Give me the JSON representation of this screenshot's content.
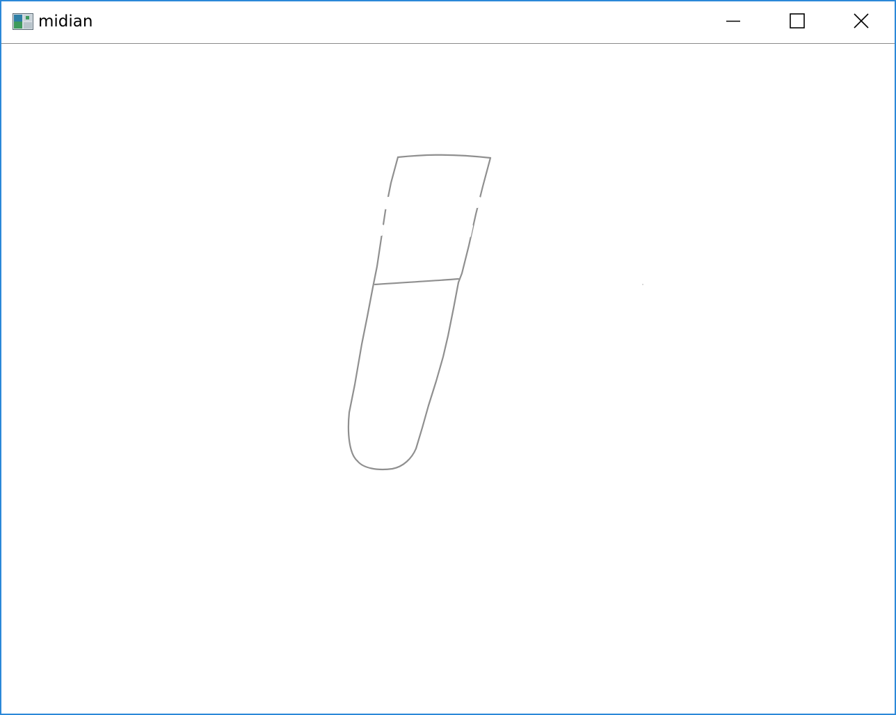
{
  "window": {
    "title": "midian",
    "frame_color": "#2b88d8",
    "app_icon": "app-window-icon",
    "controls": {
      "minimize_icon": "minimize-icon",
      "maximize_icon": "maximize-icon",
      "close_icon": "close-icon"
    }
  },
  "canvas": {
    "background": "#ffffff",
    "stroke_color": "#8f8f8f"
  }
}
